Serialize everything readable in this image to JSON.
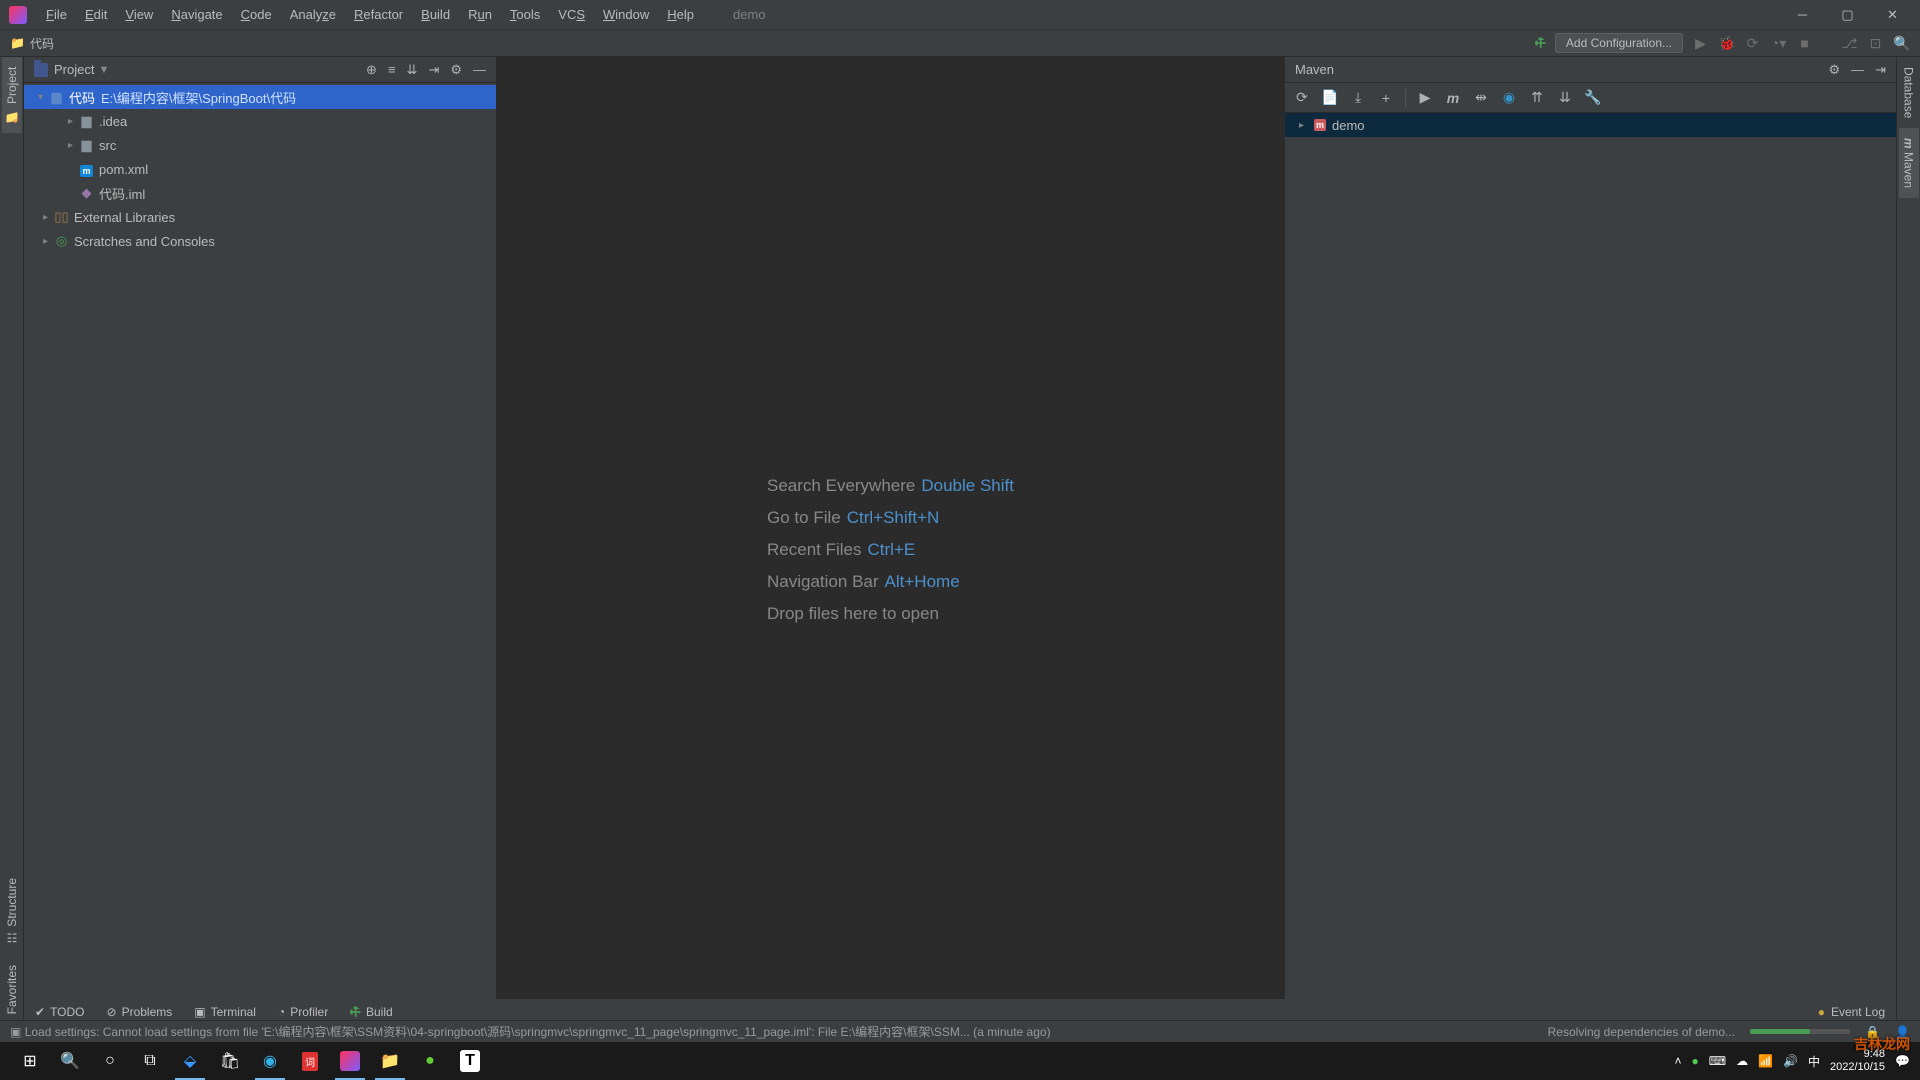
{
  "menu": [
    "File",
    "Edit",
    "View",
    "Navigate",
    "Code",
    "Analyze",
    "Refactor",
    "Build",
    "Run",
    "Tools",
    "VCS",
    "Window",
    "Help"
  ],
  "tab_name": "demo",
  "navbar": {
    "breadcrumb": "代码",
    "add_config": "Add Configuration..."
  },
  "project_panel": {
    "title": "Project"
  },
  "tree": {
    "root": "代码",
    "root_path": "E:\\编程内容\\框架\\SpringBoot\\代码",
    "n1": ".idea",
    "n2": "src",
    "n3": "pom.xml",
    "n4": "代码.iml",
    "ext": "External Libraries",
    "scratch": "Scratches and Consoles"
  },
  "maven": {
    "title": "Maven",
    "project": "demo"
  },
  "hints": {
    "h1": "Search Everywhere",
    "k1": "Double Shift",
    "h2": "Go to File",
    "k2": "Ctrl+Shift+N",
    "h3": "Recent Files",
    "k3": "Ctrl+E",
    "h4": "Navigation Bar",
    "k4": "Alt+Home",
    "h5": "Drop files here to open"
  },
  "bottom_tabs": {
    "todo": "TODO",
    "problems": "Problems",
    "terminal": "Terminal",
    "profiler": "Profiler",
    "build": "Build",
    "event_log": "Event Log"
  },
  "status": {
    "left": "Load settings: Cannot load settings from file 'E:\\编程内容\\框架\\SSM资料\\04-springboot\\源码\\springmvc\\springmvc_11_page\\springmvc_11_page.iml': File E:\\编程内容\\框架\\SSM... (a minute ago)",
    "right": "Resolving dependencies of demo..."
  },
  "sidebar_left": {
    "project": "Project",
    "structure": "Structure",
    "favorites": "Favorites"
  },
  "sidebar_right": {
    "database": "Database",
    "maven": "Maven"
  },
  "tray": {
    "ime": "中",
    "time": "9:48",
    "date": "2022/10/15",
    "watermark": "吉林龙网"
  }
}
